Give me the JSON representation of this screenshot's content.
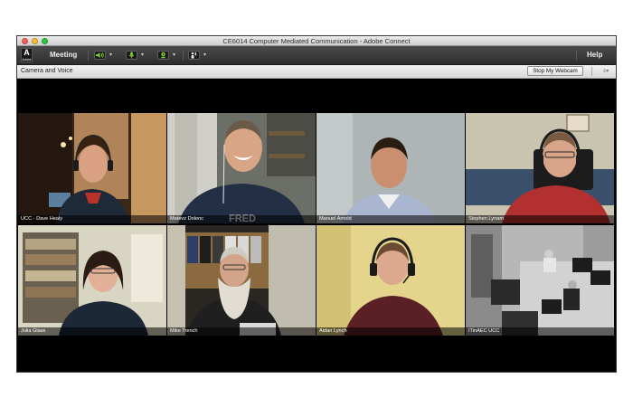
{
  "window": {
    "title": "CE6014 Computer Mediated Communication - Adobe Connect",
    "traffic_lights": {
      "close": "#fc5f57",
      "minimize": "#fdbc2e",
      "zoom": "#29c840"
    }
  },
  "menubar": {
    "logo_letter": "A",
    "logo_word": "Adobe",
    "meeting_label": "Meeting",
    "help_label": "Help",
    "toolbar_icons": [
      "speaker-icon",
      "microphone-icon",
      "webcam-icon",
      "raise-hand-icon"
    ],
    "accent": "#7fd62a"
  },
  "pod": {
    "title": "Camera and Voice",
    "stop_webcam_label": "Stop My Webcam",
    "menu_icon": "pod-options-icon"
  },
  "participants": [
    {
      "name": "UCC - Dave Healy"
    },
    {
      "name": "Matevz Dolenc"
    },
    {
      "name": "Manuel Arnold"
    },
    {
      "name": "Stephen Lynam"
    },
    {
      "name": "Julia Glass"
    },
    {
      "name": "Mike Trench"
    },
    {
      "name": "Aidan Lynch"
    },
    {
      "name": "ITinAEC UCC"
    }
  ]
}
